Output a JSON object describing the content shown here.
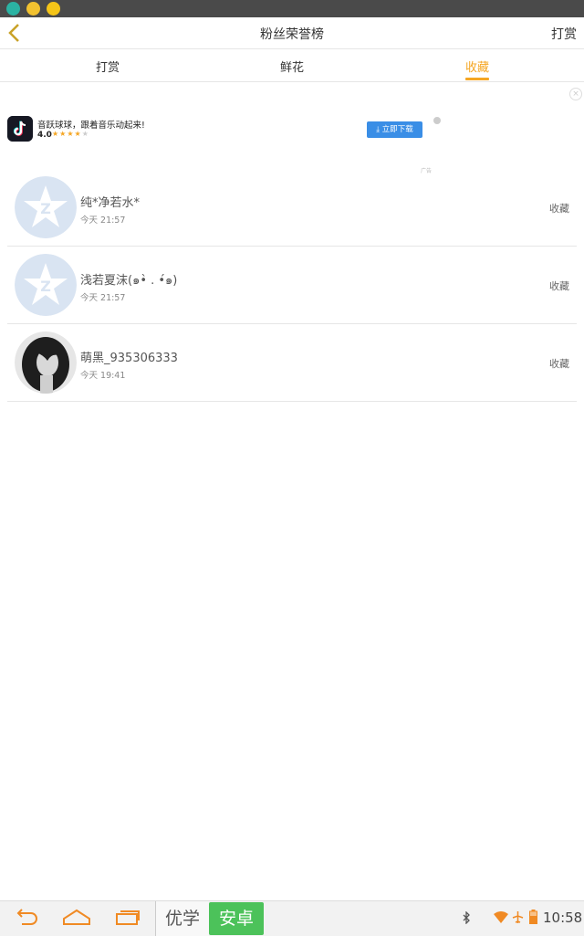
{
  "header": {
    "title": "粉丝荣誉榜",
    "right_action": "打赏"
  },
  "tabs": [
    {
      "label": "打赏",
      "active": false
    },
    {
      "label": "鲜花",
      "active": false
    },
    {
      "label": "收藏",
      "active": true
    }
  ],
  "ad": {
    "title": "音跃球球，跟着音乐动起来!",
    "rating": "4.0",
    "stars_filled": 4,
    "stars_total": 5,
    "button_label": "立即下载",
    "ad_label": "广告"
  },
  "fans": [
    {
      "name": "纯*净若水*",
      "time": "今天 21:57",
      "action": "收藏",
      "avatar": "default-avatar-icon"
    },
    {
      "name": "浅若夏沫(๑•̀ . •́๑)",
      "time": "今天 21:57",
      "action": "收藏",
      "avatar": "default-avatar-icon"
    },
    {
      "name": "萌黑_935306333",
      "time": "今天 19:41",
      "action": "收藏",
      "avatar": "photo-avatar"
    }
  ],
  "navbar": {
    "brand_left": "优学",
    "brand_right": "安卓",
    "time": "10:58"
  },
  "colors": {
    "accent": "#f5a623",
    "status_bar": "#4a4a4a",
    "brand_green": "#4cc25a",
    "button_blue": "#3a8ee6"
  }
}
